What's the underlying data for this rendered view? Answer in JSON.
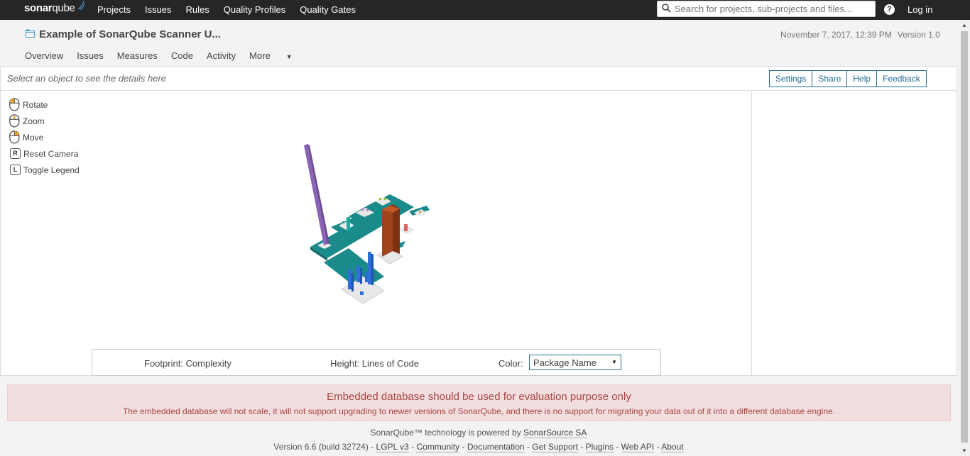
{
  "topbar": {
    "logo_text": "sonar",
    "logo_text2": "qube",
    "nav": [
      "Projects",
      "Issues",
      "Rules",
      "Quality Profiles",
      "Quality Gates"
    ],
    "search_placeholder": "Search for projects, sub-projects and files...",
    "help_glyph": "?",
    "login_label": "Log in"
  },
  "project": {
    "title": "Example of SonarQube Scanner U...",
    "date": "November 7, 2017, 12:39 PM",
    "version": "Version 1.0",
    "tabs": [
      "Overview",
      "Issues",
      "Measures",
      "Code",
      "Activity",
      "More"
    ]
  },
  "viewer": {
    "detail_hint": "Select an object to see the details here",
    "buttons": [
      "Settings",
      "Share",
      "Help",
      "Feedback"
    ],
    "controls": [
      {
        "icon": "mouse-left-icon",
        "label": "Rotate"
      },
      {
        "icon": "mouse-wheel-icon",
        "label": "Zoom"
      },
      {
        "icon": "mouse-right-icon",
        "label": "Move"
      },
      {
        "key": "R",
        "label": "Reset Camera"
      },
      {
        "key": "L",
        "label": "Toggle Legend"
      }
    ],
    "legend": {
      "footprint": "Footprint: Complexity",
      "height": "Height: Lines of Code",
      "color_label": "Color:",
      "color_value": "Package Name"
    },
    "colors": {
      "district": "#1b8a8a",
      "blue": "#2d6fd6",
      "brown": "#a0421a",
      "purple": "#8a63b5"
    }
  },
  "warning": {
    "title": "Embedded database should be used for evaluation purpose only",
    "text": "The embedded database will not scale, it will not support upgrading to newer versions of SonarQube, and there is no support for migrating your data out of it into a different database engine."
  },
  "footer": {
    "line1_prefix": "SonarQube™ technology is powered by",
    "line1_link": "SonarSource SA",
    "version": "Version 6.6 (build 32724)",
    "links": [
      "LGPL v3",
      "Community",
      "Documentation",
      "Get Support",
      "Plugins",
      "Web API",
      "About"
    ],
    "separator": "-"
  }
}
